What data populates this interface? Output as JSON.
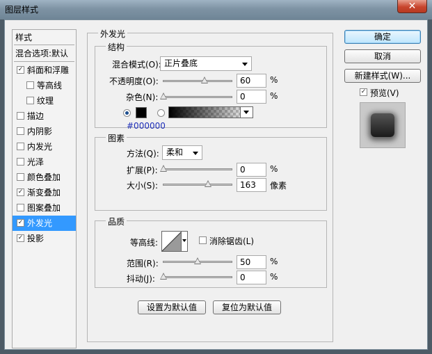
{
  "window": {
    "title": "图层样式",
    "close_glyph": "✕"
  },
  "stylelist": {
    "header": "样式",
    "blend_default": "混合选项:默认",
    "items": [
      {
        "label": "斜面和浮雕",
        "checked": true
      },
      {
        "label": "等高线",
        "checked": false
      },
      {
        "label": "纹理",
        "checked": false
      },
      {
        "label": "描边",
        "checked": false
      },
      {
        "label": "内阴影",
        "checked": false
      },
      {
        "label": "内发光",
        "checked": false
      },
      {
        "label": "光泽",
        "checked": false
      },
      {
        "label": "颜色叠加",
        "checked": false
      },
      {
        "label": "渐变叠加",
        "checked": true
      },
      {
        "label": "图案叠加",
        "checked": false
      },
      {
        "label": "外发光",
        "checked": true,
        "selected": true
      },
      {
        "label": "投影",
        "checked": true
      }
    ],
    "check_glyph": "✓"
  },
  "outer_glow": {
    "title": "外发光",
    "structure": {
      "title": "结构",
      "blend_mode_label": "混合模式(O):",
      "blend_mode_value": "正片叠底",
      "opacity_label": "不透明度(O):",
      "opacity_value": "60",
      "opacity_level": 0.6,
      "noise_label": "杂色(N):",
      "noise_value": "0",
      "noise_level": 0,
      "percent": "%",
      "color_hex": "#000000",
      "color": "#000000",
      "color_radio_selected": true
    },
    "elements": {
      "title": "图素",
      "method_label": "方法(Q):",
      "method_value": "柔和",
      "spread_label": "扩展(P):",
      "spread_value": "0",
      "spread_level": 0,
      "size_label": "大小(S):",
      "size_value": "163",
      "size_unit": "像素",
      "size_level": 0.65,
      "percent": "%"
    },
    "quality": {
      "title": "品质",
      "contour_label": "等高线:",
      "antialias_label": "消除锯齿(L)",
      "antialias_checked": false,
      "range_label": "范围(R):",
      "range_value": "50",
      "range_level": 0.5,
      "jitter_label": "抖动(J):",
      "jitter_value": "0",
      "jitter_level": 0,
      "percent": "%"
    },
    "make_default": "设置为默认值",
    "reset_default": "复位为默认值"
  },
  "actions": {
    "ok": "确定",
    "cancel": "取消",
    "new_style": "新建样式(W)...",
    "preview_label": "预览(V)",
    "preview_checked": true
  }
}
